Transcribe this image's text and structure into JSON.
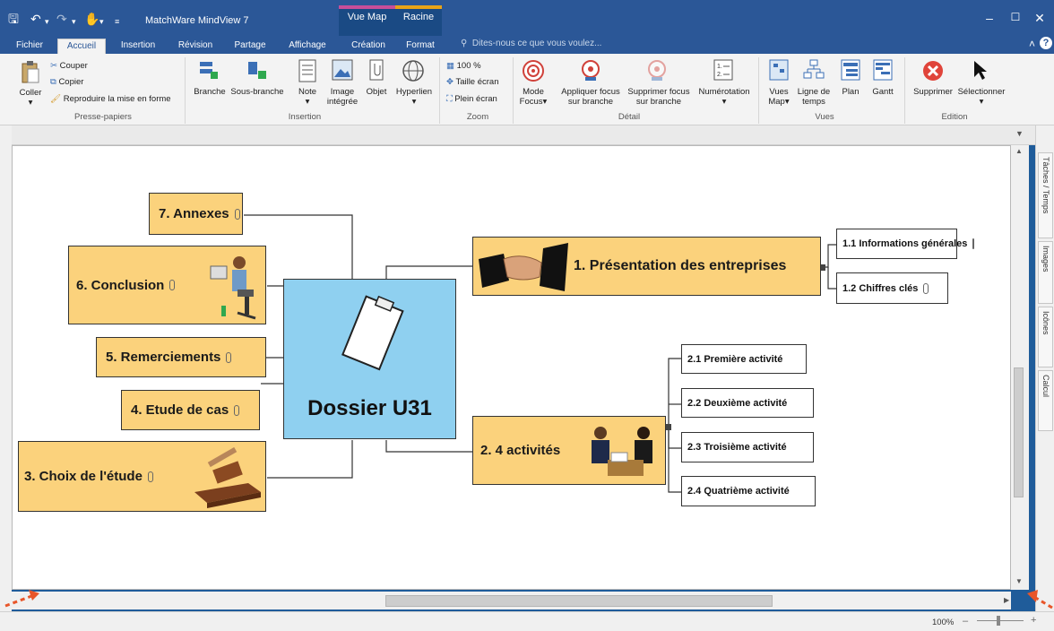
{
  "app": {
    "title": "MatchWare MindView 7",
    "context_tab_map": "Vue Map",
    "context_tab_root": "Racine"
  },
  "tabs": [
    "Fichier",
    "Accueil",
    "Insertion",
    "Révision",
    "Partage",
    "Affichage",
    "Création",
    "Format"
  ],
  "tell_me": "Dites-nous ce que vous voulez...",
  "ribbon": {
    "clipboard": {
      "coller": "Coller",
      "couper": "Couper",
      "copier": "Copier",
      "reproduire": "Reproduire la mise en forme",
      "label": "Presse-papiers"
    },
    "insertion": {
      "branche": "Branche",
      "sous_branche": "Sous-branche",
      "note": "Note",
      "image1": "Image",
      "image2": "intégrée",
      "objet": "Objet",
      "hyperlien": "Hyperlien",
      "label": "Insertion"
    },
    "zoom": {
      "z100": "100 %",
      "taille": "Taille écran",
      "plein": "Plein écran",
      "label": "Zoom"
    },
    "detail": {
      "mode1": "Mode",
      "mode2": "Focus",
      "appliquer1": "Appliquer focus",
      "appliquer2": "sur branche",
      "supprimer1": "Supprimer focus",
      "supprimer2": "sur branche",
      "numerotation": "Numérotation",
      "label": "Détail"
    },
    "vues": {
      "vues1": "Vues",
      "vues2": "Map",
      "ligne1": "Ligne de",
      "ligne2": "temps",
      "plan": "Plan",
      "gantt": "Gantt",
      "label": "Vues"
    },
    "edition": {
      "supprimer": "Supprimer",
      "selectionner": "Sélectionner",
      "label": "Edition"
    }
  },
  "side_tabs": [
    "Tâches / Temps",
    "Images",
    "Icônes",
    "Calcul"
  ],
  "map": {
    "center": "Dossier U31",
    "left": [
      "7. Annexes",
      "6. Conclusion",
      "5. Remerciements",
      "4. Etude de cas",
      "3. Choix de l'étude"
    ],
    "right": [
      {
        "label": "1. Présentation des entreprises",
        "subs": [
          "1.1 Informations générales",
          "1.2 Chiffres clés"
        ]
      },
      {
        "label": "2. 4 activités",
        "subs": [
          "2.1 Première activité",
          "2.2 Deuxième activité",
          "2.3 Troisième activité",
          "2.4 Quatrième activité"
        ]
      }
    ]
  },
  "status": {
    "zoom": "100%"
  }
}
